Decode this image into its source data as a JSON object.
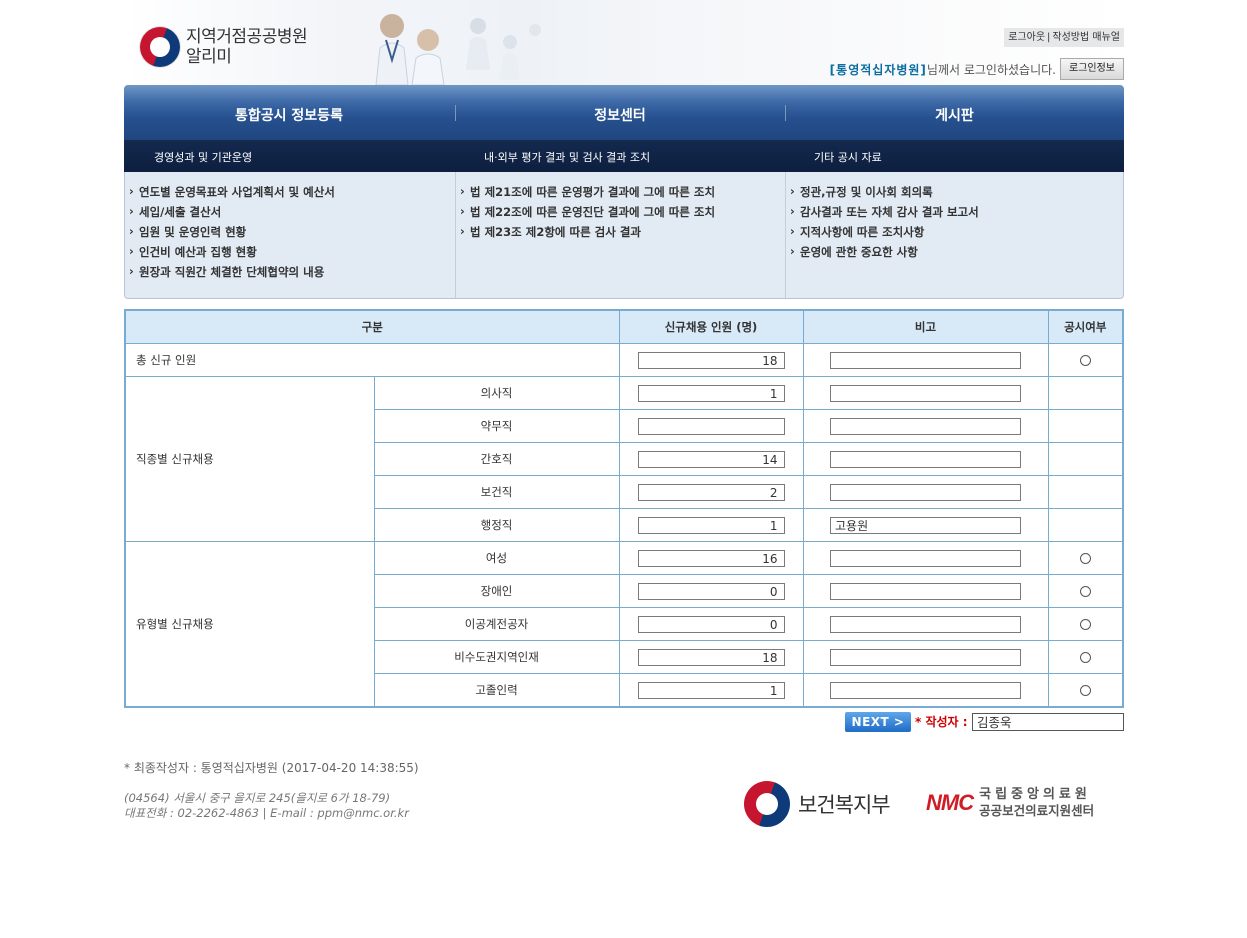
{
  "header": {
    "site_name_line1": "지역거점공공병원",
    "site_name_line2": "알리미",
    "top_links": [
      "로그아웃",
      "작성방법 매뉴얼"
    ],
    "hospital_name": "[통영적십자병원]",
    "login_message": "님께서 로그인하셨습니다.",
    "login_info_button": "로그인정보"
  },
  "nav": {
    "main": [
      "통합공시 정보등록",
      "정보센터",
      "게시판"
    ],
    "sub": [
      "경영성과 및 기관운영",
      "내·외부 평가 결과 및 검사 결과 조치",
      "기타 공시 자료"
    ],
    "col1": [
      "연도별 운영목표와 사업계획서 및 예산서",
      "세입/세출 결산서",
      "임원 및 운영인력 현황",
      "인건비 예산과 집행 현황",
      "원장과 직원간 체결한 단체협약의 내용"
    ],
    "col2": [
      "법 제21조에 따른 운영평가 결과에 그에 따른 조치",
      "법 제22조에 따른 운영진단 결과에 그에 따른 조치",
      "법 제23조 제2항에 따른 검사 결과"
    ],
    "col3": [
      "정관,규정 및 이사회 회의록",
      "감사결과 또는 자체 감사 결과 보고서",
      "지적사항에 따른 조치사항",
      "운영에 관한 중요한 사항"
    ]
  },
  "table": {
    "headers": [
      "구분",
      "신규채용 인원 (명)",
      "비고",
      "공시여부"
    ],
    "total_label": "총 신규 인원",
    "total_value": "18",
    "group1_label": "직종별 신규채용",
    "group2_label": "유형별 신규채용",
    "rows": [
      {
        "label": "의사직",
        "value": "1",
        "note": ""
      },
      {
        "label": "약무직",
        "value": "",
        "note": ""
      },
      {
        "label": "간호직",
        "value": "14",
        "note": ""
      },
      {
        "label": "보건직",
        "value": "2",
        "note": ""
      },
      {
        "label": "행정직",
        "value": "1",
        "note": "고용원"
      },
      {
        "label": "여성",
        "value": "16",
        "note": ""
      },
      {
        "label": "장애인",
        "value": "0",
        "note": ""
      },
      {
        "label": "이공계전공자",
        "value": "0",
        "note": ""
      },
      {
        "label": "비수도권지역인재",
        "value": "18",
        "note": ""
      },
      {
        "label": "고졸인력",
        "value": "1",
        "note": ""
      }
    ]
  },
  "form": {
    "next_button": "NEXT >",
    "author_label": "* 작성자 :",
    "author_value": "김종욱"
  },
  "footer": {
    "last_author": "* 최종작성자 : 통영적십자병원 (2017-04-20 14:38:55)",
    "address": "(04564) 서울시 중구 을지로 245(을지로 6가 18-79)",
    "contact": "대표전화 : 02-2262-4863 | E-mail : ppm@nmc.or.kr",
    "ministry": "보건복지부",
    "nmc_logo": "NMC",
    "nmc_line1": "국립중앙의료원",
    "nmc_line2": "공공보건의료지원센터"
  }
}
